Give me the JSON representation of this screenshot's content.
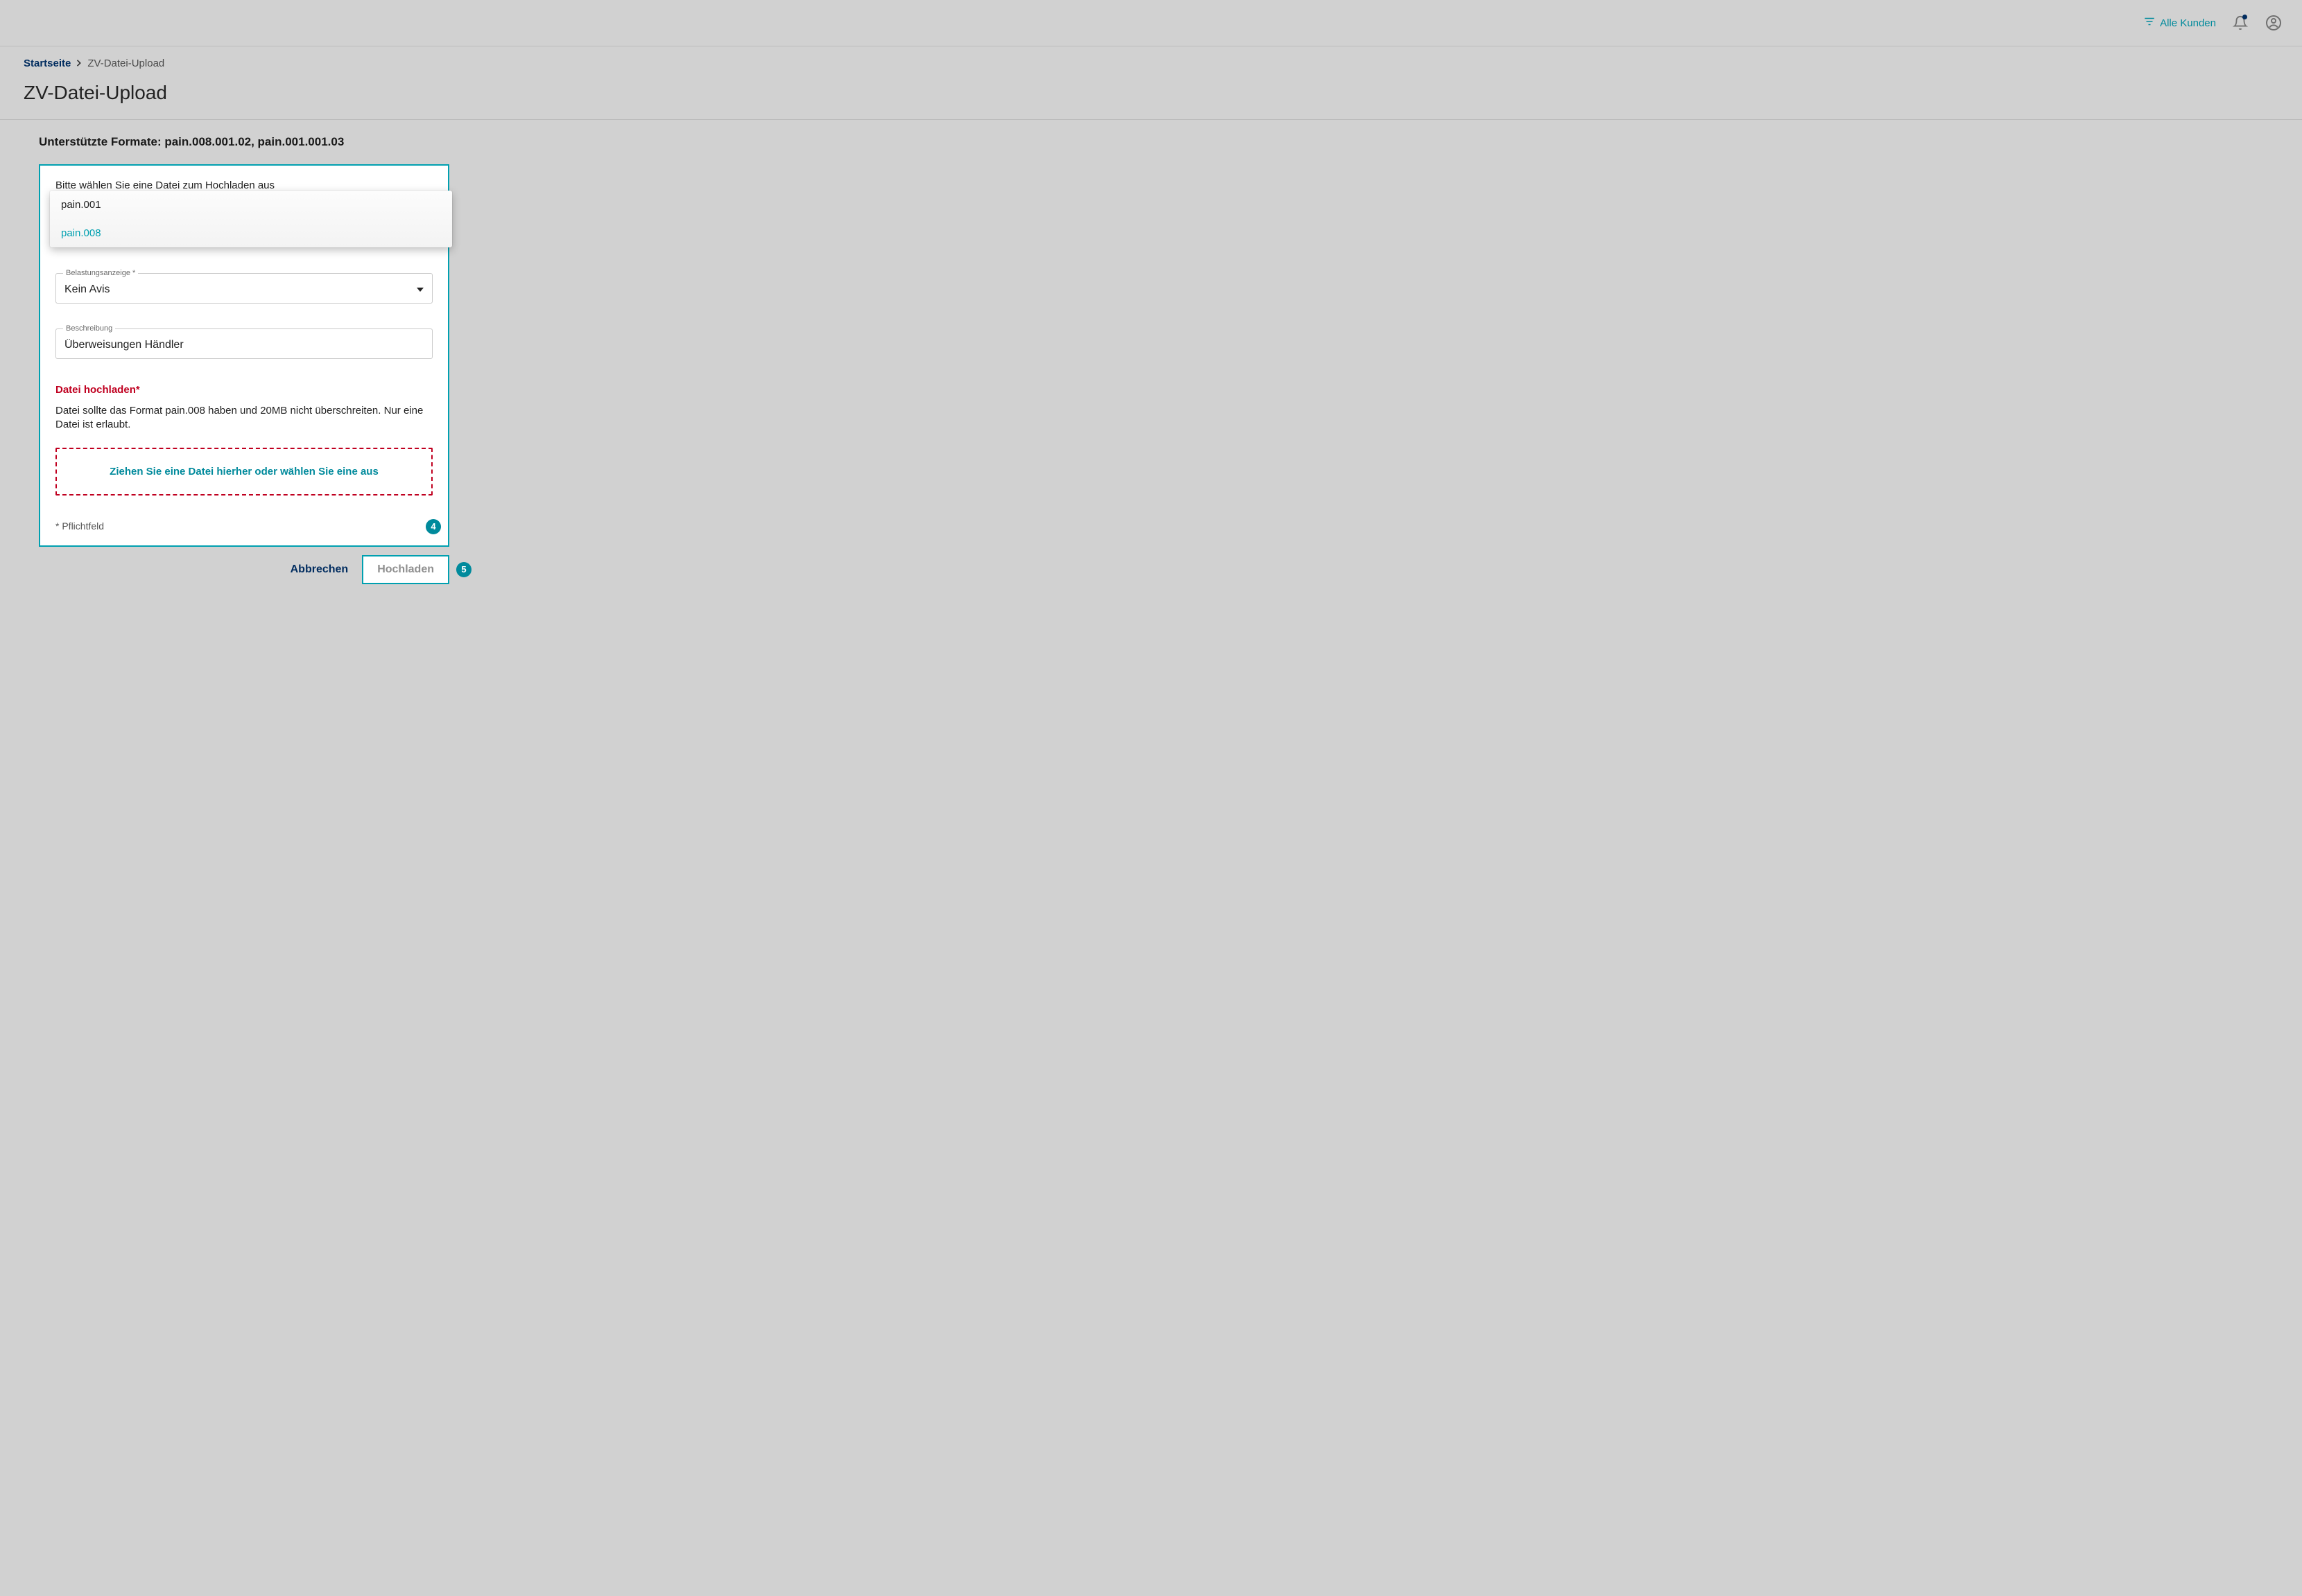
{
  "header": {
    "filter_label": "Alle Kunden"
  },
  "breadcrumb": {
    "home": "Startseite",
    "current": "ZV-Datei-Upload"
  },
  "page": {
    "title": "ZV-Datei-Upload",
    "supported_formats": "Unterstützte Formate: pain.008.001.02, pain.001.001.03"
  },
  "panel": {
    "choose_prompt": "Bitte wählen Sie eine Datei zum Hochladen aus",
    "type_options": [
      "pain.001",
      "pain.008"
    ],
    "type_selected": "pain.008",
    "debit_label": "Belastungsanzeige *",
    "debit_value": "Kein Avis",
    "desc_label": "Beschreibung",
    "desc_value": "Überweisungen Händler",
    "upload_title": "Datei hochladen*",
    "upload_hint": "Datei sollte das Format pain.008 haben und 20MB nicht überschreiten. Nur eine Datei ist erlaubt.",
    "dropzone_text": "Ziehen Sie eine Datei hierher oder wählen Sie eine aus",
    "required_note": "* Pflichtfeld"
  },
  "actions": {
    "cancel": "Abbrechen",
    "upload": "Hochladen"
  },
  "badges": {
    "four": "4",
    "five": "5"
  }
}
